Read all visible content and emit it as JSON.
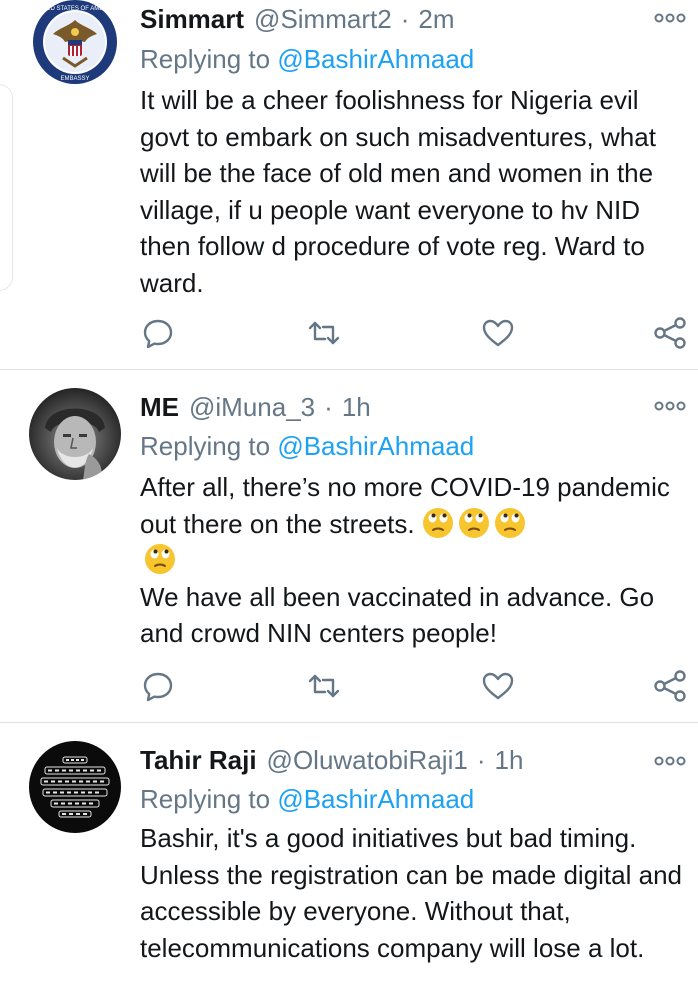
{
  "tweets": [
    {
      "name": "Simmart",
      "handle": "@Simmart2",
      "separator": "·",
      "time": "2m",
      "replying_prefix": "Replying to",
      "replying_to": "@BashirAhmaad",
      "text": "It will be a cheer foolishness for Nigeria evil govt to embark on such misadventures, what will be the face of old men and women in the village, if u people want everyone to hv NID then follow d procedure of vote reg. Ward to ward.",
      "avatar_icon": "us-embassy-seal-icon",
      "avatar_seal_top": "UNITED STATES OF AMERICA",
      "avatar_seal_bottom": "EMBASSY"
    },
    {
      "name": "ME",
      "handle": "@iMuna_3",
      "separator": "·",
      "time": "1h",
      "replying_prefix": "Replying to",
      "replying_to": "@BashirAhmaad",
      "text_line1": "After all, there’s no more COVID-19 pandemic out there on the streets.",
      "emoji_name": "face-with-rolling-eyes-icon",
      "text_line2": "We have all been vaccinated in advance. Go and crowd NIN centers people!",
      "avatar_icon": "elderly-man-photo-icon"
    },
    {
      "name": "Tahir Raji",
      "handle": "@OluwatobiRaji1",
      "separator": "·",
      "time": "1h",
      "replying_prefix": "Replying to",
      "replying_to": "@BashirAhmaad",
      "text": "Bashir, it's a good initiatives but bad timing. Unless the registration can be made digital and accessible by everyone. Without that, telecommunications company will lose a lot.",
      "avatar_icon": "text-logo-avatar-icon"
    }
  ],
  "colors": {
    "text": "#14171a",
    "secondary": "#657786",
    "link": "#1da1f2",
    "divider": "#dfe3e7"
  }
}
